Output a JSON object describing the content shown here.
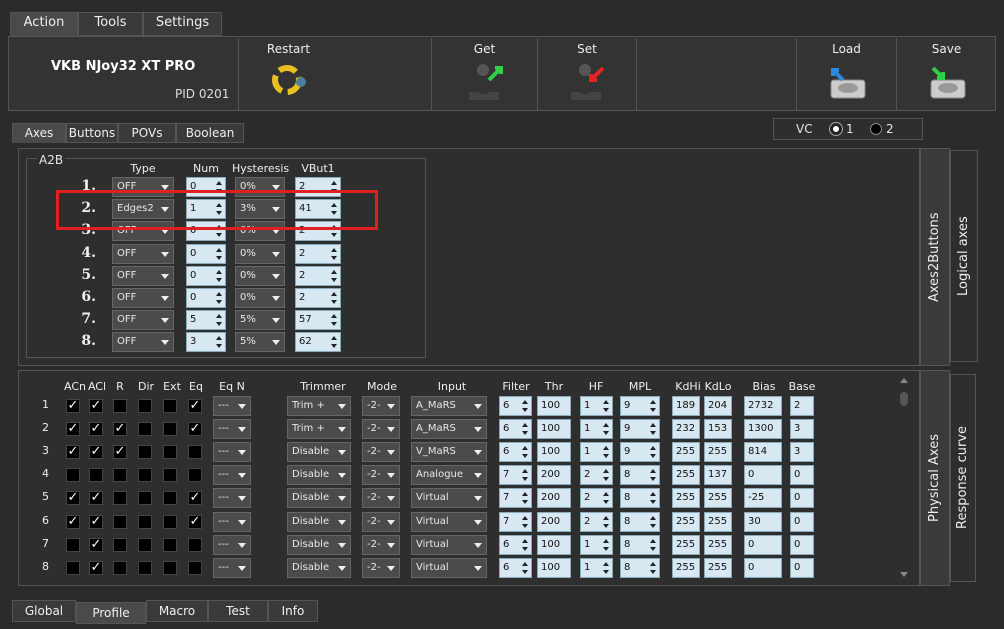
{
  "top_tabs": [
    "Action",
    "Tools",
    "Settings"
  ],
  "device": {
    "name": "VKB NJoy32 XT PRO",
    "pid": "PID 0201"
  },
  "toolbar": {
    "restart": "Restart",
    "get": "Get",
    "set": "Set",
    "load": "Load",
    "save": "Save"
  },
  "sub_tabs": [
    "Axes",
    "Buttons",
    "POVs",
    "Boolean"
  ],
  "vc": {
    "label": "VC",
    "opt1": "1",
    "opt2": "2"
  },
  "a2b": {
    "title": "A2B",
    "headers": {
      "type": "Type",
      "num": "Num",
      "hyst": "Hysteresis",
      "vbut": "VBut1"
    },
    "rows": [
      {
        "n": "1.",
        "type": "OFF",
        "num": "0",
        "hyst": "0%",
        "vbut": "2"
      },
      {
        "n": "2.",
        "type": "Edges2",
        "num": "1",
        "hyst": "3%",
        "vbut": "41"
      },
      {
        "n": "3.",
        "type": "OFF",
        "num": "0",
        "hyst": "0%",
        "vbut": "2"
      },
      {
        "n": "4.",
        "type": "OFF",
        "num": "0",
        "hyst": "0%",
        "vbut": "2"
      },
      {
        "n": "5.",
        "type": "OFF",
        "num": "0",
        "hyst": "0%",
        "vbut": "2"
      },
      {
        "n": "6.",
        "type": "OFF",
        "num": "0",
        "hyst": "0%",
        "vbut": "2"
      },
      {
        "n": "7.",
        "type": "OFF",
        "num": "5",
        "hyst": "5%",
        "vbut": "57"
      },
      {
        "n": "8.",
        "type": "OFF",
        "num": "3",
        "hyst": "5%",
        "vbut": "62"
      }
    ]
  },
  "side_tabs_top": {
    "a": "Axes2Buttons",
    "b": "Logical axes"
  },
  "side_tabs_bottom": {
    "a": "Physical Axes",
    "b": "Response curve"
  },
  "phys": {
    "headers": {
      "acn": "ACn",
      "acl": "ACl",
      "r": "R",
      "dir": "Dir",
      "ext": "Ext",
      "eq": "Eq",
      "eqn": "Eq N",
      "trimmer": "Trimmer",
      "mode": "Mode",
      "input": "Input",
      "filter": "Filter",
      "thr": "Thr",
      "hf": "HF",
      "mpl": "MPL",
      "kdhi": "KdHi",
      "kdlo": "KdLo",
      "bias": "Bias",
      "base": "Base"
    },
    "rows": [
      {
        "n": "1",
        "acn": true,
        "acl": true,
        "r": false,
        "dir": false,
        "ext": false,
        "eq": true,
        "eqn": "---",
        "trim": "Trim +",
        "mode": "-2-",
        "input": "A_MaRS",
        "filter": "6",
        "thr": "100",
        "hf": "1",
        "mpl": "9",
        "kdhi": "189",
        "kdlo": "204",
        "bias": "2732",
        "base": "2"
      },
      {
        "n": "2",
        "acn": true,
        "acl": true,
        "r": true,
        "dir": false,
        "ext": false,
        "eq": true,
        "eqn": "---",
        "trim": "Trim +",
        "mode": "-2-",
        "input": "A_MaRS",
        "filter": "6",
        "thr": "100",
        "hf": "1",
        "mpl": "9",
        "kdhi": "232",
        "kdlo": "153",
        "bias": "1300",
        "base": "3"
      },
      {
        "n": "3",
        "acn": true,
        "acl": true,
        "r": true,
        "dir": false,
        "ext": false,
        "eq": false,
        "eqn": "---",
        "trim": "Disable",
        "mode": "-2-",
        "input": "V_MaRS",
        "filter": "6",
        "thr": "100",
        "hf": "1",
        "mpl": "9",
        "kdhi": "255",
        "kdlo": "255",
        "bias": "814",
        "base": "3"
      },
      {
        "n": "4",
        "acn": false,
        "acl": false,
        "r": false,
        "dir": false,
        "ext": false,
        "eq": false,
        "eqn": "---",
        "trim": "Disable",
        "mode": "-2-",
        "input": "Analogue",
        "filter": "7",
        "thr": "200",
        "hf": "2",
        "mpl": "8",
        "kdhi": "255",
        "kdlo": "137",
        "bias": "0",
        "base": "0"
      },
      {
        "n": "5",
        "acn": true,
        "acl": true,
        "r": false,
        "dir": false,
        "ext": false,
        "eq": true,
        "eqn": "---",
        "trim": "Disable",
        "mode": "-2-",
        "input": "Virtual",
        "filter": "7",
        "thr": "200",
        "hf": "2",
        "mpl": "8",
        "kdhi": "255",
        "kdlo": "255",
        "bias": "-25",
        "base": "0"
      },
      {
        "n": "6",
        "acn": true,
        "acl": true,
        "r": false,
        "dir": false,
        "ext": false,
        "eq": true,
        "eqn": "---",
        "trim": "Disable",
        "mode": "-2-",
        "input": "Virtual",
        "filter": "7",
        "thr": "200",
        "hf": "2",
        "mpl": "8",
        "kdhi": "255",
        "kdlo": "255",
        "bias": "30",
        "base": "0"
      },
      {
        "n": "7",
        "acn": false,
        "acl": true,
        "r": false,
        "dir": false,
        "ext": false,
        "eq": false,
        "eqn": "---",
        "trim": "Disable",
        "mode": "-2-",
        "input": "Virtual",
        "filter": "6",
        "thr": "100",
        "hf": "1",
        "mpl": "8",
        "kdhi": "255",
        "kdlo": "255",
        "bias": "0",
        "base": "0"
      },
      {
        "n": "8",
        "acn": false,
        "acl": true,
        "r": false,
        "dir": false,
        "ext": false,
        "eq": false,
        "eqn": "---",
        "trim": "Disable",
        "mode": "-2-",
        "input": "Virtual",
        "filter": "6",
        "thr": "100",
        "hf": "1",
        "mpl": "8",
        "kdhi": "255",
        "kdlo": "255",
        "bias": "0",
        "base": "0"
      }
    ]
  },
  "bottom_tabs": [
    "Global",
    "Profile",
    "Macro",
    "Test",
    "Info"
  ],
  "colors": {
    "highlight": "#e02020"
  }
}
